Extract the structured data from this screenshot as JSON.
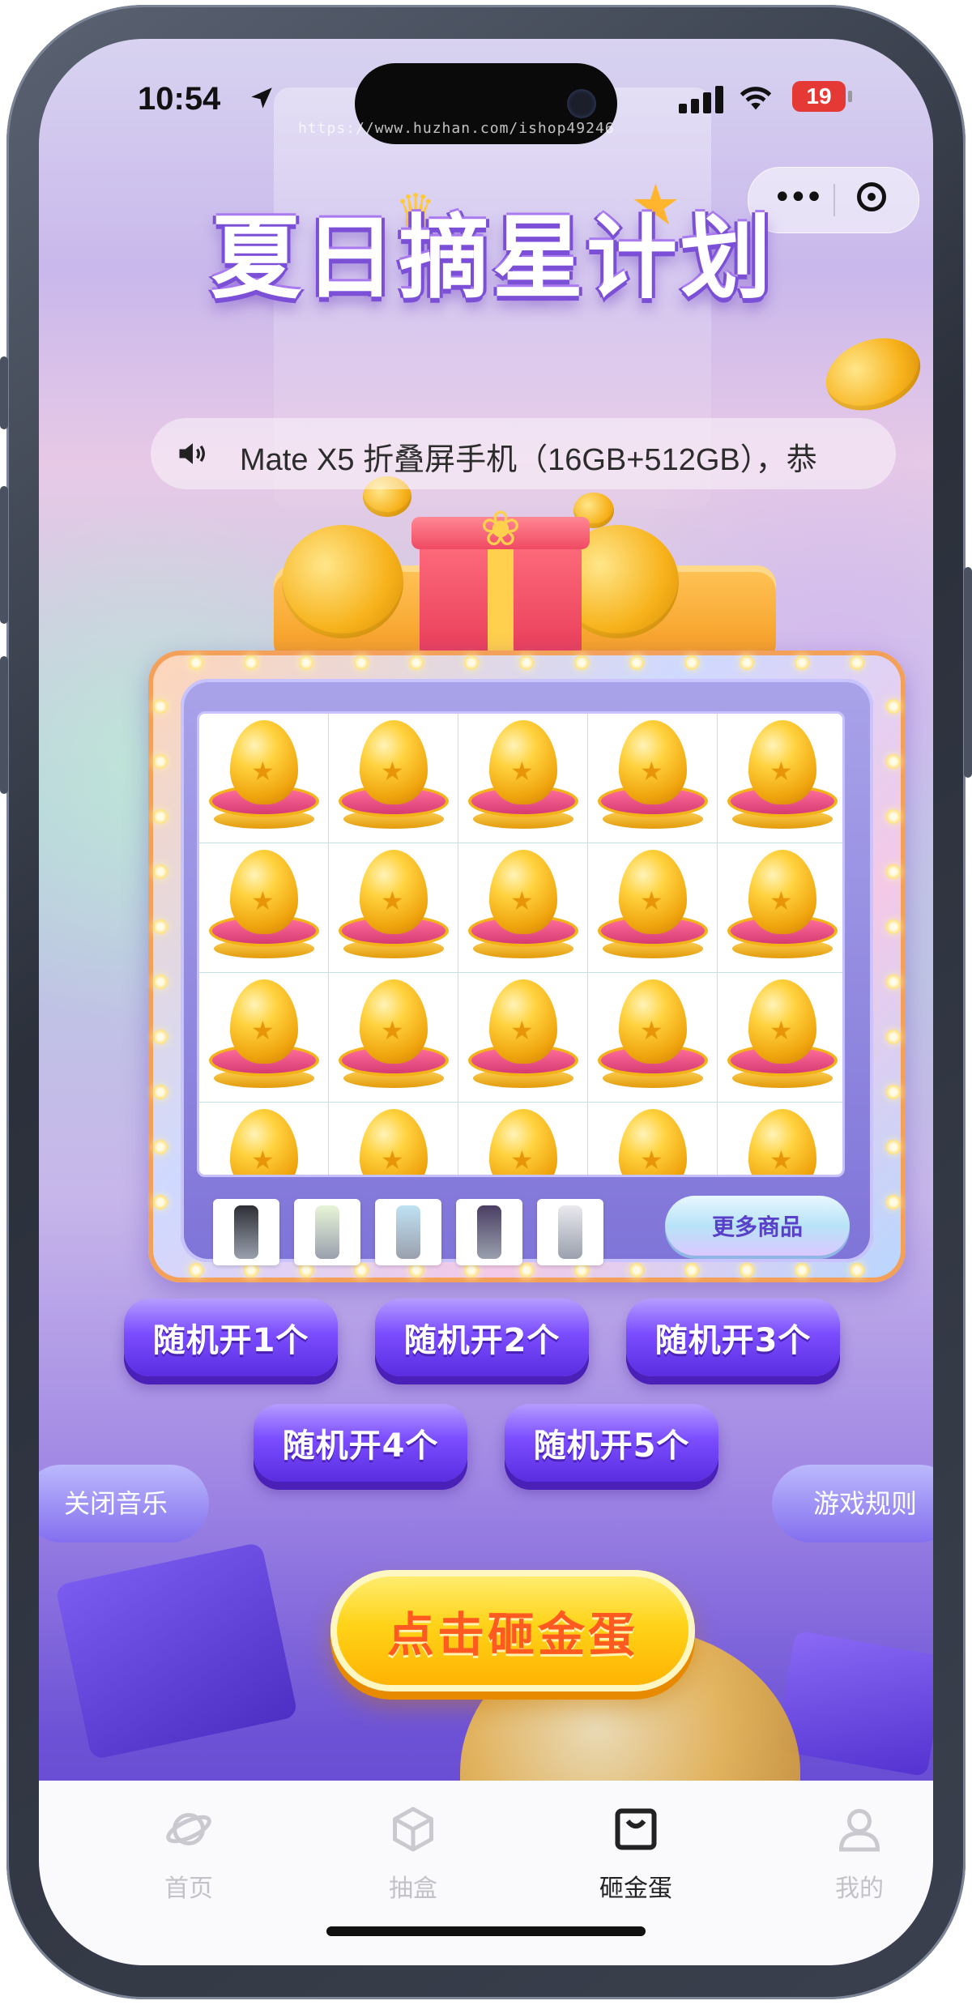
{
  "status_bar": {
    "time": "10:54",
    "battery": "19"
  },
  "watermark": "https://www.huzhan.com/ishop49246",
  "title": "夏日摘星计划",
  "notice": {
    "text": "Mate X5 折叠屏手机（16GB+512GB），恭"
  },
  "grid": {
    "rows": 4,
    "cols": 5,
    "visible_cells": 20,
    "item": "golden-egg"
  },
  "products": [
    {
      "name": "phone-1",
      "color": "#2d2f35"
    },
    {
      "name": "phone-2",
      "color": "#e9f5d9"
    },
    {
      "name": "phone-3",
      "color": "#bfe2f3"
    },
    {
      "name": "phone-4",
      "color": "#4a3e63"
    },
    {
      "name": "phone-5",
      "color": "#e9e9ee"
    }
  ],
  "more_products_label": "更多商品",
  "open_buttons": [
    "随机开1个",
    "随机开2个",
    "随机开3个",
    "随机开4个",
    "随机开5个"
  ],
  "close_music_label": "关闭音乐",
  "game_rules_label": "游戏规则",
  "smash_label": "点击砸金蛋",
  "tabs": [
    {
      "label": "首页",
      "icon": "planet-icon",
      "active": false
    },
    {
      "label": "抽盒",
      "icon": "box-icon",
      "active": false
    },
    {
      "label": "砸金蛋",
      "icon": "bag-icon",
      "active": true
    },
    {
      "label": "我的",
      "icon": "person-icon",
      "active": false
    }
  ]
}
